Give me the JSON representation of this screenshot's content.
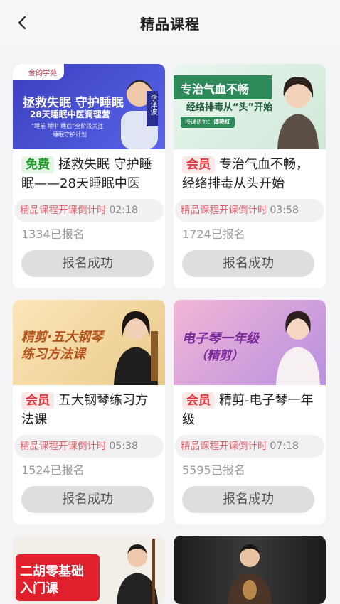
{
  "header": {
    "title": "精品课程",
    "back_icon": "chevron-left-icon"
  },
  "courses": [
    {
      "thumb_brand": "金韵学苑",
      "thumb_title": "拯救失眠 守护睡眠",
      "thumb_sub": "28天睡眠中医调理营",
      "thumb_note1": "“睡前 睡中 睡后”全阶段关注",
      "thumb_note2": "睡眠守护计划",
      "thumb_teacher": "李泽波",
      "tag": "免费",
      "title": "拯救失眠 守护睡眠——28天睡眠中医",
      "countdown_label": "精品课程开课倒计时",
      "countdown_time": "02:18",
      "enrolled": "1334已报名",
      "button": "报名成功"
    },
    {
      "thumb_title": "专治气血不畅",
      "thumb_sub": "经络排毒从“头”开始",
      "thumb_teacher_label": "授课讲师：",
      "thumb_teacher": "谭艳红",
      "thumb_year": "2024",
      "tag": "会员",
      "title": "专治气血不畅，经络排毒从头开始",
      "countdown_label": "精品课程开课倒计时",
      "countdown_time": "03:58",
      "enrolled": "1724已报名",
      "button": "报名成功"
    },
    {
      "thumb_title": "精剪·五大钢琴",
      "thumb_sub": "练习方法课",
      "tag": "会员",
      "title": "五大钢琴练习方法课",
      "countdown_label": "精品课程开课倒计时",
      "countdown_time": "05:38",
      "enrolled": "1524已报名",
      "button": "报名成功"
    },
    {
      "thumb_title": "电子琴一年级",
      "thumb_sub": "（精剪）",
      "tag": "会员",
      "title": "精剪-电子琴一年级",
      "countdown_label": "精品课程开课倒计时",
      "countdown_time": "07:18",
      "enrolled": "5595已报名",
      "button": "报名成功"
    },
    {
      "thumb_title": "二胡零基础",
      "thumb_sub": "入门课"
    },
    {}
  ]
}
